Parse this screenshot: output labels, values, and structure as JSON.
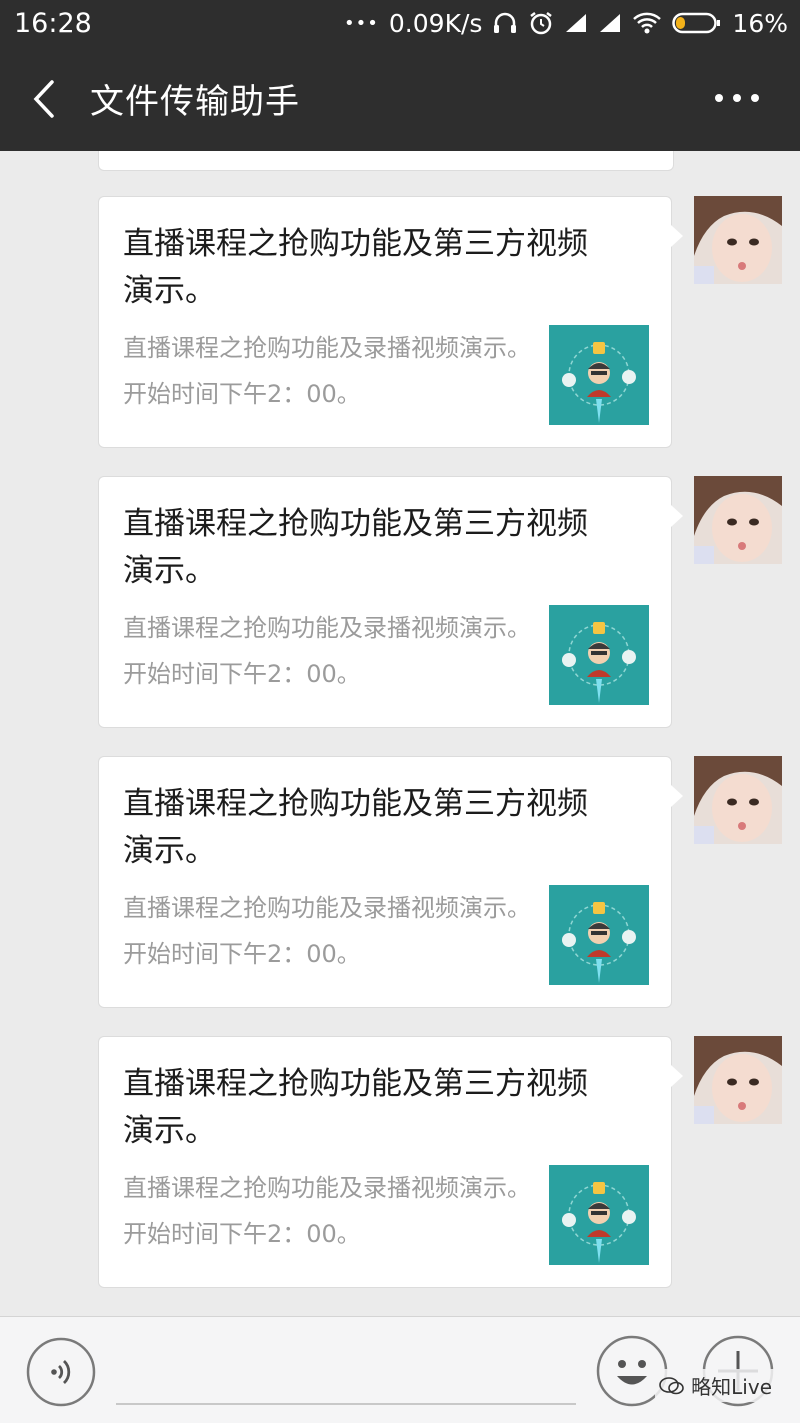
{
  "status_bar": {
    "time": "16:28",
    "more": "•••",
    "speed": "0.09K/s",
    "battery": "16%",
    "icons": [
      "headphones-icon",
      "alarm-icon",
      "signal-icon",
      "signal-icon",
      "wifi-icon",
      "battery-icon"
    ]
  },
  "header": {
    "title": "文件传输助手",
    "back_icon": "chevron-left-icon",
    "more_icon": "more-icon"
  },
  "messages": [
    {
      "title": "直播课程之抢购功能及第三方视频演示。",
      "description": "直播课程之抢购功能及录播视频演示。开始时间下午2：00。"
    },
    {
      "title": "直播课程之抢购功能及第三方视频演示。",
      "description": "直播课程之抢购功能及录播视频演示。开始时间下午2：00。"
    },
    {
      "title": "直播课程之抢购功能及第三方视频演示。",
      "description": "直播课程之抢购功能及录播视频演示。开始时间下午2：00。"
    },
    {
      "title": "直播课程之抢购功能及第三方视频演示。",
      "description": "直播课程之抢购功能及录播视频演示。开始时间下午2：00。"
    }
  ],
  "input_bar": {
    "voice_icon": "voice-icon",
    "emoji_icon": "emoji-icon",
    "plus_icon": "plus-icon"
  },
  "watermark": "略知Live",
  "colors": {
    "header_bg": "#2e2e2e",
    "chat_bg": "#ebebeb",
    "thumb_bg": "#2aa1a0"
  }
}
